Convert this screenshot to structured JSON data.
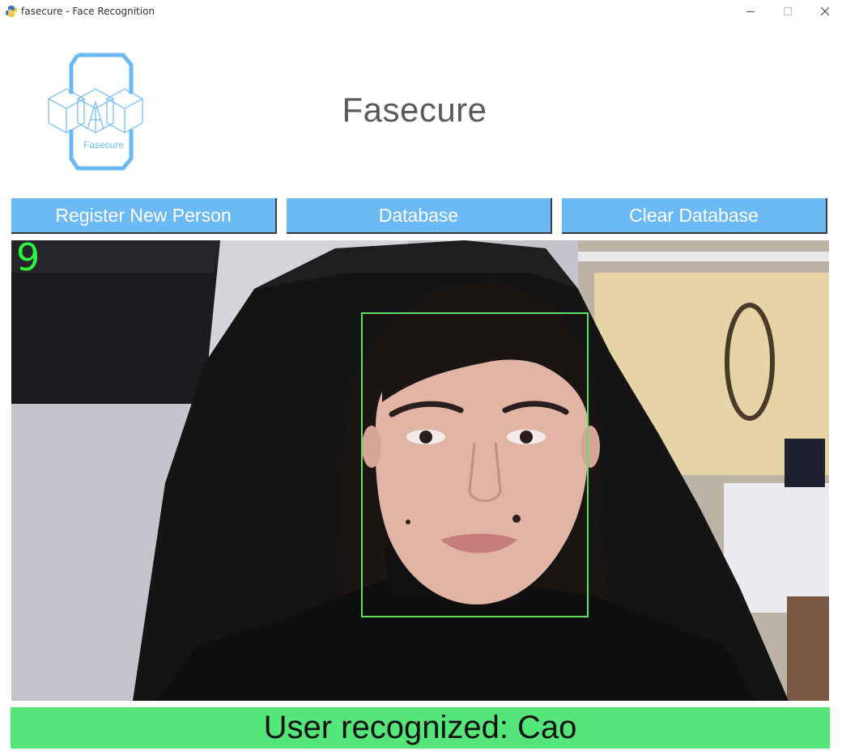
{
  "window": {
    "title": "fasecure - Face Recognition",
    "icon": "python-icon",
    "controls": {
      "minimize": "minimize-icon",
      "maximize": "maximize-icon",
      "close": "close-icon"
    }
  },
  "header": {
    "logo_text": "Fasecure",
    "app_name": "Fasecure"
  },
  "toolbar": {
    "register_label": "Register New Person",
    "database_label": "Database",
    "clear_label": "Clear Database"
  },
  "camera": {
    "fps_counter": "9"
  },
  "status": {
    "message": "User recognized: Cao"
  },
  "colors": {
    "accent": "#6bbaf6",
    "status_ok": "#55e67a",
    "face_box": "#5fe065",
    "fps_text": "#2cf23a",
    "heading": "#5a5a5a"
  }
}
